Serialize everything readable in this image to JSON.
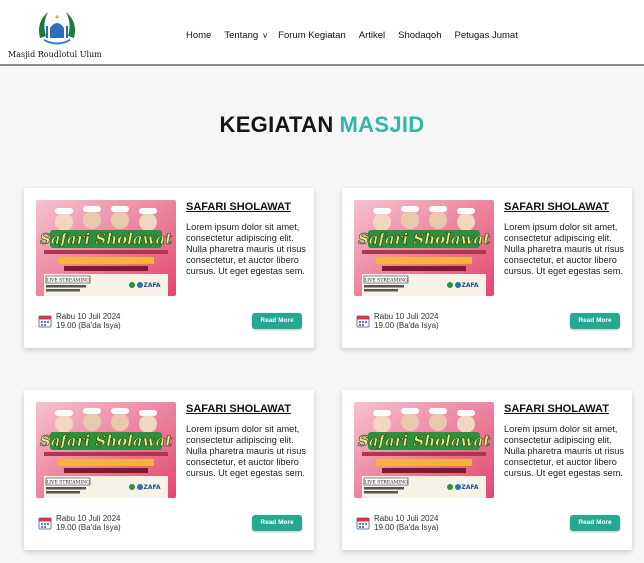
{
  "brand": {
    "name": "Masjid Roudlotul Ulum"
  },
  "nav": {
    "home": "Home",
    "tentang": "Tentang",
    "tentang_chevron": "v",
    "forum": "Forum Kegiatan",
    "artikel": "Artikel",
    "shodaqoh": "Shodaqoh",
    "petugas": "Petugas Jumat"
  },
  "section": {
    "title_part1": "KEGIATAN",
    "title_part2": "MASJID"
  },
  "colors": {
    "accent": "#2fb9a4",
    "button": "#22a98f"
  },
  "cards": [
    {
      "title": "SAFARI SHOLAWAT",
      "description": "Lorem ipsum dolor sit amet, consectetur adipiscing elit. Nulla pharetra mauris ut risus consectetur, et auctor libero cursus. Ut eget egestas sem.",
      "date": "Rabu 10 Juli 2024",
      "time": "19.00 (Ba'da Isya)",
      "button": "Read More",
      "poster": {
        "headline": "Safari Sholawat",
        "badge": "LIVE STREAMING",
        "sponsor": "ZAFA"
      }
    },
    {
      "title": "SAFARI SHOLAWAT",
      "description": "Lorem ipsum dolor sit amet, consectetur adipiscing elit. Nulla pharetra mauris ut risus consectetur, et auctor libero cursus. Ut eget egestas sem.",
      "date": "Rabu 10 Juli 2024",
      "time": "19.00 (Ba'da Isya)",
      "button": "Read More",
      "poster": {
        "headline": "Safari Sholawat",
        "badge": "LIVE STREAMING",
        "sponsor": "ZAFA"
      }
    },
    {
      "title": "SAFARI SHOLAWAT",
      "description": "Lorem ipsum dolor sit amet, consectetur adipiscing elit. Nulla pharetra mauris ut risus consectetur, et auctor libero cursus. Ut eget egestas sem.",
      "date": "Rabu 10 Juli 2024",
      "time": "19.00 (Ba'da Isya)",
      "button": "Read More",
      "poster": {
        "headline": "Safari Sholawat",
        "badge": "LIVE STREAMING",
        "sponsor": "ZAFA"
      }
    },
    {
      "title": "SAFARI SHOLAWAT",
      "description": "Lorem ipsum dolor sit amet, consectetur adipiscing elit. Nulla pharetra mauris ut risus consectetur, et auctor libero cursus. Ut eget egestas sem.",
      "date": "Rabu 10 Juli 2024",
      "time": "19.00 (Ba'da Isya)",
      "button": "Read More",
      "poster": {
        "headline": "Safari Sholawat",
        "badge": "LIVE STREAMING",
        "sponsor": "ZAFA"
      }
    }
  ]
}
